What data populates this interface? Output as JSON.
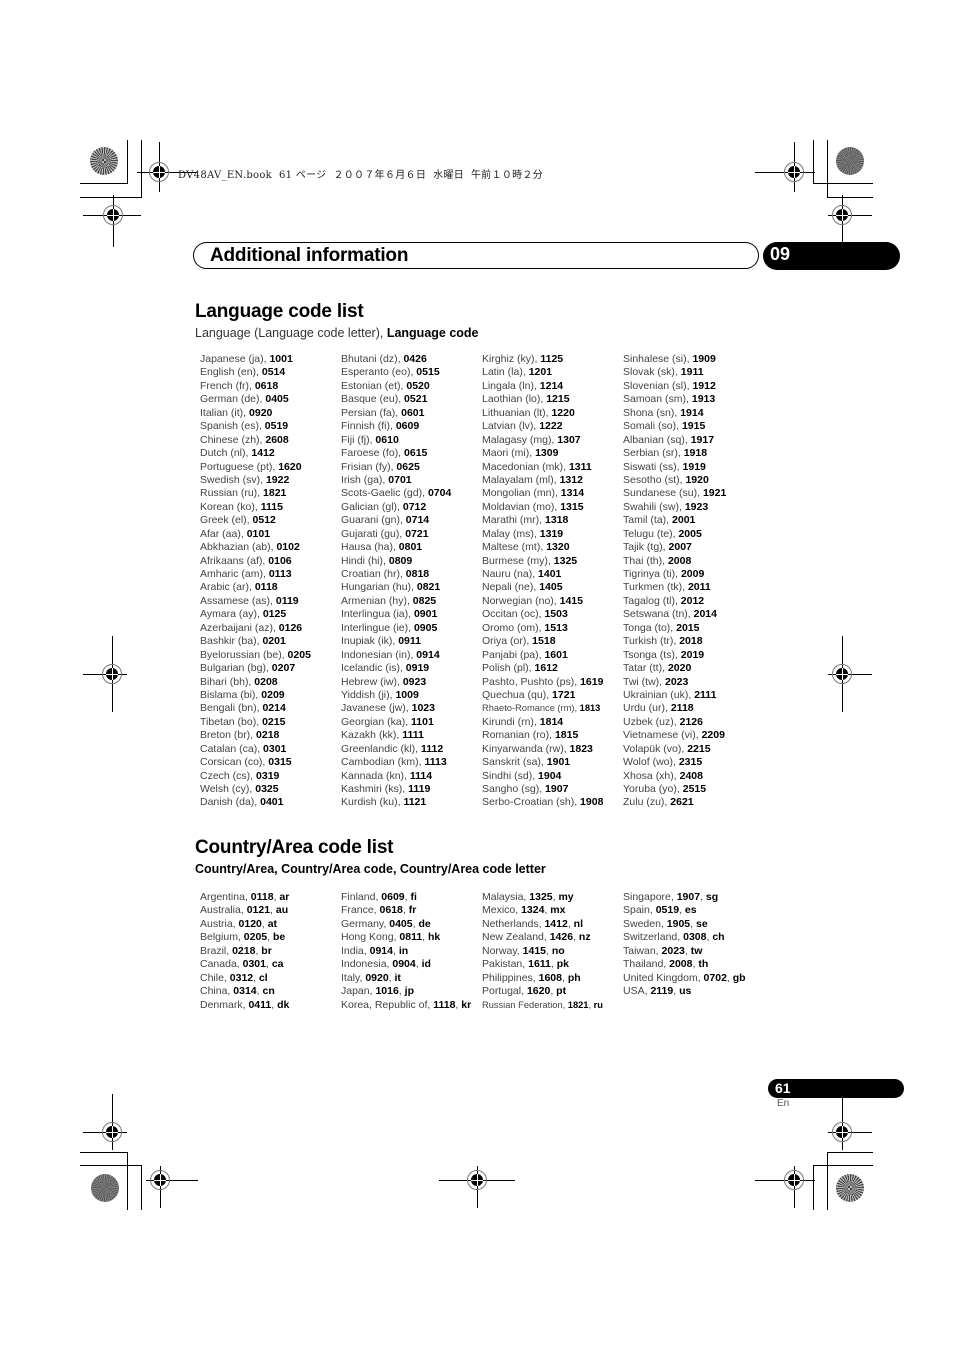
{
  "slug": "DV48AV_EN.book  61 ページ  ２００７年６月６日  水曜日  午前１０時２分",
  "header": {
    "chapter_title": "Additional information",
    "chapter_number": "09"
  },
  "language_section": {
    "title": "Language code list",
    "subtitle_plain": "Language (Language code letter), ",
    "subtitle_bold": "Language code",
    "columns": [
      [
        {
          "name": "Japanese (ja), ",
          "code": "1001"
        },
        {
          "name": "English (en), ",
          "code": "0514"
        },
        {
          "name": "French (fr), ",
          "code": "0618"
        },
        {
          "name": "German (de), ",
          "code": "0405"
        },
        {
          "name": "Italian (it), ",
          "code": "0920"
        },
        {
          "name": "Spanish (es), ",
          "code": "0519"
        },
        {
          "name": "Chinese (zh), ",
          "code": "2608"
        },
        {
          "name": "Dutch (nl), ",
          "code": "1412"
        },
        {
          "name": "Portuguese (pt), ",
          "code": "1620"
        },
        {
          "name": "Swedish (sv), ",
          "code": "1922"
        },
        {
          "name": "Russian (ru), ",
          "code": "1821"
        },
        {
          "name": "Korean (ko), ",
          "code": "1115"
        },
        {
          "name": "Greek (el), ",
          "code": "0512"
        },
        {
          "name": "Afar (aa), ",
          "code": "0101"
        },
        {
          "name": "Abkhazian (ab), ",
          "code": "0102"
        },
        {
          "name": "Afrikaans (af), ",
          "code": "0106"
        },
        {
          "name": "Amharic (am), ",
          "code": "0113"
        },
        {
          "name": "Arabic (ar), ",
          "code": "0118"
        },
        {
          "name": "Assamese (as), ",
          "code": "0119"
        },
        {
          "name": "Aymara (ay), ",
          "code": "0125"
        },
        {
          "name": "Azerbaijani (az), ",
          "code": "0126"
        },
        {
          "name": "Bashkir (ba), ",
          "code": "0201"
        },
        {
          "name": "Byelorussian (be), ",
          "code": "0205"
        },
        {
          "name": "Bulgarian (bg), ",
          "code": "0207"
        },
        {
          "name": "Bihari (bh), ",
          "code": "0208"
        },
        {
          "name": "Bislama (bi), ",
          "code": "0209"
        },
        {
          "name": "Bengali (bn), ",
          "code": "0214"
        },
        {
          "name": "Tibetan (bo), ",
          "code": "0215"
        },
        {
          "name": "Breton (br), ",
          "code": "0218"
        },
        {
          "name": "Catalan (ca), ",
          "code": "0301"
        },
        {
          "name": "Corsican (co), ",
          "code": "0315"
        },
        {
          "name": "Czech (cs), ",
          "code": "0319"
        },
        {
          "name": "Welsh (cy), ",
          "code": "0325"
        },
        {
          "name": "Danish (da), ",
          "code": "0401"
        }
      ],
      [
        {
          "name": "Bhutani (dz), ",
          "code": "0426"
        },
        {
          "name": "Esperanto (eo), ",
          "code": "0515"
        },
        {
          "name": "Estonian (et), ",
          "code": "0520"
        },
        {
          "name": "Basque (eu), ",
          "code": "0521"
        },
        {
          "name": "Persian (fa), ",
          "code": "0601"
        },
        {
          "name": "Finnish (fi), ",
          "code": "0609"
        },
        {
          "name": "Fiji (fj), ",
          "code": "0610"
        },
        {
          "name": "Faroese (fo), ",
          "code": "0615"
        },
        {
          "name": "Frisian (fy), ",
          "code": "0625"
        },
        {
          "name": "Irish (ga), ",
          "code": "0701"
        },
        {
          "name": "Scots-Gaelic (gd), ",
          "code": "0704"
        },
        {
          "name": "Galician (gl), ",
          "code": "0712"
        },
        {
          "name": "Guarani (gn), ",
          "code": "0714"
        },
        {
          "name": "Gujarati (gu), ",
          "code": "0721"
        },
        {
          "name": "Hausa (ha), ",
          "code": "0801"
        },
        {
          "name": "Hindi (hi), ",
          "code": "0809"
        },
        {
          "name": "Croatian (hr), ",
          "code": "0818"
        },
        {
          "name": "Hungarian (hu), ",
          "code": "0821"
        },
        {
          "name": "Armenian (hy), ",
          "code": "0825"
        },
        {
          "name": "Interlingua (ia), ",
          "code": "0901"
        },
        {
          "name": "Interlingue (ie), ",
          "code": "0905"
        },
        {
          "name": "Inupiak (ik), ",
          "code": "0911"
        },
        {
          "name": "Indonesian (in), ",
          "code": "0914"
        },
        {
          "name": "Icelandic (is), ",
          "code": "0919"
        },
        {
          "name": "Hebrew (iw), ",
          "code": "0923"
        },
        {
          "name": "Yiddish (ji), ",
          "code": "1009"
        },
        {
          "name": "Javanese (jw), ",
          "code": "1023"
        },
        {
          "name": "Georgian (ka), ",
          "code": "1101"
        },
        {
          "name": "Kazakh (kk), ",
          "code": "1111"
        },
        {
          "name": "Greenlandic  (kl), ",
          "code": "1112"
        },
        {
          "name": "Cambodian (km), ",
          "code": "1113"
        },
        {
          "name": "Kannada (kn), ",
          "code": "1114"
        },
        {
          "name": "Kashmiri (ks), ",
          "code": "1119"
        },
        {
          "name": "Kurdish (ku), ",
          "code": "1121"
        }
      ],
      [
        {
          "name": "Kirghiz (ky), ",
          "code": "1125"
        },
        {
          "name": "Latin (la), ",
          "code": "1201"
        },
        {
          "name": "Lingala (ln), ",
          "code": "1214"
        },
        {
          "name": "Laothian (lo), ",
          "code": "1215"
        },
        {
          "name": "Lithuanian (lt), ",
          "code": "1220"
        },
        {
          "name": "Latvian (lv), ",
          "code": "1222"
        },
        {
          "name": "Malagasy (mg), ",
          "code": "1307"
        },
        {
          "name": "Maori (mi), ",
          "code": "1309"
        },
        {
          "name": "Macedonian (mk), ",
          "code": "1311"
        },
        {
          "name": "Malayalam  (ml), ",
          "code": "1312"
        },
        {
          "name": "Mongolian (mn), ",
          "code": "1314"
        },
        {
          "name": "Moldavian (mo), ",
          "code": "1315"
        },
        {
          "name": "Marathi (mr), ",
          "code": "1318"
        },
        {
          "name": "Malay  (ms), ",
          "code": "1319"
        },
        {
          "name": "Maltese (mt), ",
          "code": "1320"
        },
        {
          "name": "Burmese (my), ",
          "code": "1325"
        },
        {
          "name": "Nauru (na), ",
          "code": "1401"
        },
        {
          "name": "Nepali (ne), ",
          "code": "1405"
        },
        {
          "name": "Norwegian (no), ",
          "code": "1415"
        },
        {
          "name": "Occitan (oc), ",
          "code": "1503"
        },
        {
          "name": "Oromo (om), ",
          "code": "1513"
        },
        {
          "name": "Oriya (or), ",
          "code": "1518"
        },
        {
          "name": "Panjabi (pa), ",
          "code": "1601"
        },
        {
          "name": "Polish (pl), ",
          "code": "1612"
        },
        {
          "name": "Pashto, Pushto (ps), ",
          "code": "1619"
        },
        {
          "name": "Quechua (qu), ",
          "code": "1721"
        },
        {
          "name": "Rhaeto-Romance (rm), ",
          "code": "1813",
          "small": true
        },
        {
          "name": "Kirundi (rn), ",
          "code": "1814"
        },
        {
          "name": "Romanian (ro), ",
          "code": "1815"
        },
        {
          "name": "Kinyarwanda (rw), ",
          "code": "1823"
        },
        {
          "name": "Sanskrit (sa), ",
          "code": "1901"
        },
        {
          "name": "Sindhi (sd), ",
          "code": "1904"
        },
        {
          "name": "Sangho (sg), ",
          "code": "1907"
        },
        {
          "name": "Serbo-Croatian (sh), ",
          "code": "1908"
        }
      ],
      [
        {
          "name": "Sinhalese (si), ",
          "code": "1909"
        },
        {
          "name": "Slovak (sk), ",
          "code": "1911"
        },
        {
          "name": "Slovenian (sl), ",
          "code": "1912"
        },
        {
          "name": "Samoan (sm), ",
          "code": "1913"
        },
        {
          "name": "Shona (sn), ",
          "code": "1914"
        },
        {
          "name": "Somali (so), ",
          "code": "1915"
        },
        {
          "name": "Albanian (sq), ",
          "code": "1917"
        },
        {
          "name": "Serbian (sr), ",
          "code": "1918"
        },
        {
          "name": "Siswati (ss), ",
          "code": "1919"
        },
        {
          "name": "Sesotho (st), ",
          "code": "1920"
        },
        {
          "name": "Sundanese (su), ",
          "code": "1921"
        },
        {
          "name": "Swahili (sw), ",
          "code": "1923"
        },
        {
          "name": "Tamil (ta), ",
          "code": "2001"
        },
        {
          "name": "Telugu (te), ",
          "code": "2005"
        },
        {
          "name": "Tajik (tg), ",
          "code": "2007"
        },
        {
          "name": "Thai (th), ",
          "code": "2008"
        },
        {
          "name": "Tigrinya (ti), ",
          "code": "2009"
        },
        {
          "name": "Turkmen (tk), ",
          "code": "2011"
        },
        {
          "name": "Tagalog (tl), ",
          "code": "2012"
        },
        {
          "name": "Setswana (tn), ",
          "code": "2014"
        },
        {
          "name": "Tonga (to), ",
          "code": "2015"
        },
        {
          "name": "Turkish (tr), ",
          "code": "2018"
        },
        {
          "name": "Tsonga (ts), ",
          "code": "2019"
        },
        {
          "name": "Tatar (tt), ",
          "code": "2020"
        },
        {
          "name": "Twi (tw), ",
          "code": "2023"
        },
        {
          "name": "Ukrainian (uk), ",
          "code": "2111"
        },
        {
          "name": "Urdu (ur), ",
          "code": "2118"
        },
        {
          "name": "Uzbek (uz), ",
          "code": "2126"
        },
        {
          "name": "Vietnamese (vi), ",
          "code": "2209"
        },
        {
          "name": "Volapük (vo), ",
          "code": "2215"
        },
        {
          "name": "Wolof (wo), ",
          "code": "2315"
        },
        {
          "name": "Xhosa (xh), ",
          "code": "2408"
        },
        {
          "name": "Yoruba (yo), ",
          "code": "2515"
        },
        {
          "name": "Zulu (zu), ",
          "code": "2621"
        }
      ]
    ]
  },
  "country_section": {
    "title": "Country/Area code list",
    "subtitle": "Country/Area, Country/Area code, Country/Area code letter",
    "columns": [
      [
        {
          "name": "Argentina, ",
          "code": "0118",
          "letter": "ar"
        },
        {
          "name": "Australia, ",
          "code": "0121",
          "letter": "au"
        },
        {
          "name": "Austria, ",
          "code": "0120",
          "letter": "at"
        },
        {
          "name": "Belgium, ",
          "code": "0205",
          "letter": "be"
        },
        {
          "name": "Brazil, ",
          "code": "0218",
          "letter": "br"
        },
        {
          "name": "Canada, ",
          "code": "0301",
          "letter": "ca"
        },
        {
          "name": "Chile, ",
          "code": "0312",
          "letter": "cl"
        },
        {
          "name": "China, ",
          "code": "0314",
          "letter": "cn"
        },
        {
          "name": "Denmark, ",
          "code": "0411",
          "letter": "dk"
        }
      ],
      [
        {
          "name": "Finland, ",
          "code": "0609",
          "letter": "fi"
        },
        {
          "name": "France, ",
          "code": "0618",
          "letter": "fr"
        },
        {
          "name": "Germany, ",
          "code": "0405",
          "letter": "de"
        },
        {
          "name": "Hong Kong, ",
          "code": "0811",
          "letter": "hk"
        },
        {
          "name": "India, ",
          "code": "0914",
          "letter": "in"
        },
        {
          "name": "Indonesia, ",
          "code": "0904",
          "letter": "id"
        },
        {
          "name": "Italy, ",
          "code": "0920",
          "letter": "it"
        },
        {
          "name": "Japan, ",
          "code": "1016",
          "letter": "jp"
        },
        {
          "name": "Korea, Republic of, ",
          "code": "1118",
          "letter": "kr"
        }
      ],
      [
        {
          "name": "Malaysia, ",
          "code": "1325",
          "letter": "my"
        },
        {
          "name": "Mexico, ",
          "code": "1324",
          "letter": "mx"
        },
        {
          "name": "Netherlands, ",
          "code": "1412",
          "letter": "nl"
        },
        {
          "name": "New Zealand, ",
          "code": "1426",
          "letter": "nz"
        },
        {
          "name": "Norway, ",
          "code": "1415",
          "letter": "no"
        },
        {
          "name": "Pakistan, ",
          "code": "1611",
          "letter": "pk"
        },
        {
          "name": "Philippines, ",
          "code": "1608",
          "letter": "ph"
        },
        {
          "name": "Portugal, ",
          "code": "1620",
          "letter": "pt"
        },
        {
          "name": "Russian Federation, ",
          "code": "1821",
          "letter": "ru",
          "small": true
        }
      ],
      [
        {
          "name": "Singapore, ",
          "code": "1907",
          "letter": "sg"
        },
        {
          "name": "Spain, ",
          "code": "0519",
          "letter": "es"
        },
        {
          "name": "Sweden, ",
          "code": "1905",
          "letter": "se"
        },
        {
          "name": "Switzerland, ",
          "code": "0308",
          "letter": "ch"
        },
        {
          "name": "Taiwan, ",
          "code": "2023",
          "letter": "tw"
        },
        {
          "name": "Thailand, ",
          "code": "2008",
          "letter": "th"
        },
        {
          "name": "United Kingdom, ",
          "code": "0702",
          "letter": "gb"
        },
        {
          "name": "USA, ",
          "code": "2119",
          "letter": "us"
        }
      ]
    ]
  },
  "footer": {
    "page_number": "61",
    "language": "En"
  }
}
